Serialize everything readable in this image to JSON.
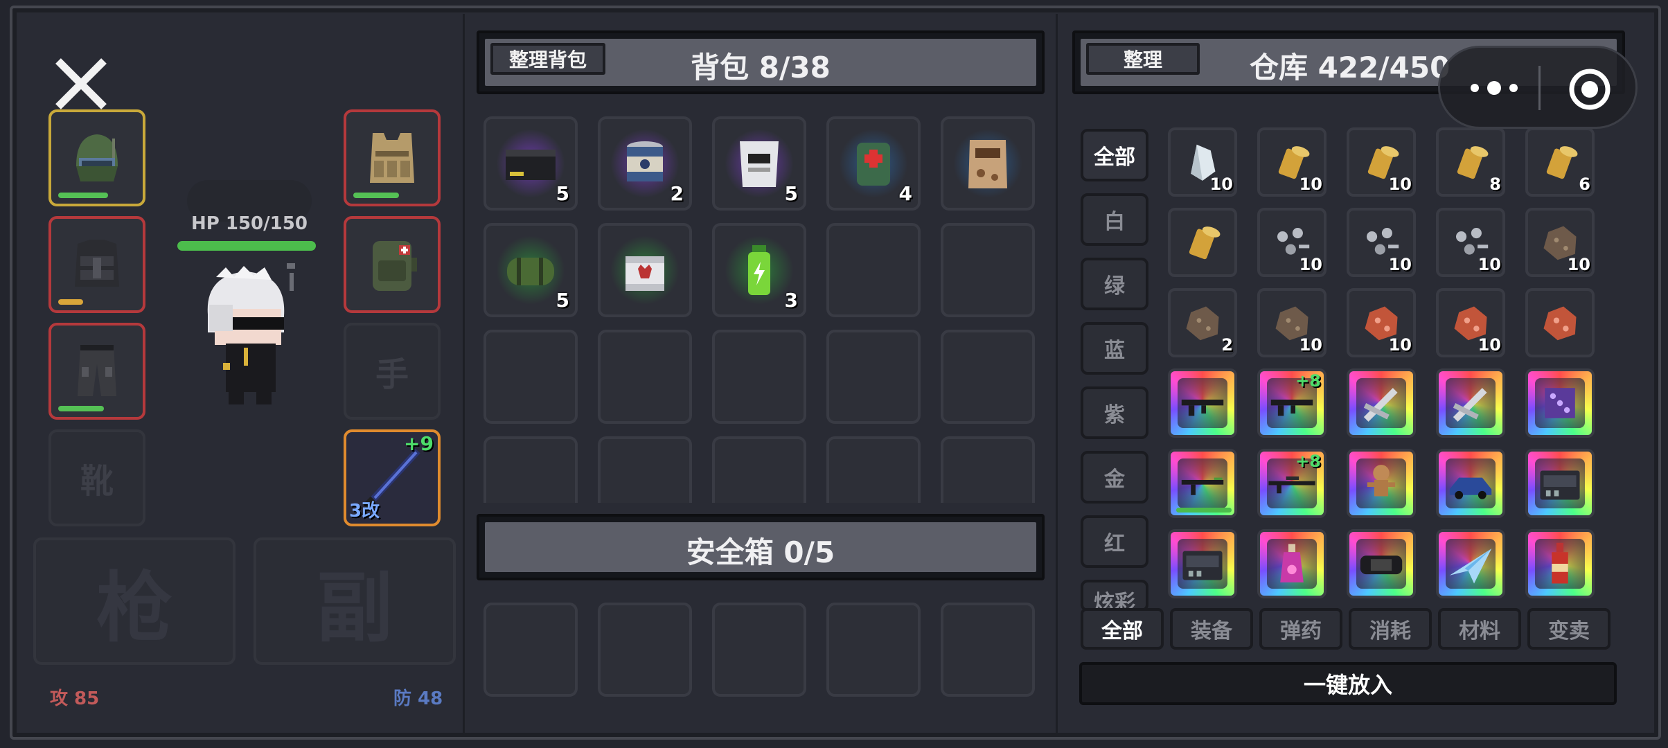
{
  "close_icon": "close-icon",
  "character": {
    "hp_label": "HP 150/150",
    "hp_fraction": 1.0,
    "attack_label": "攻 85",
    "defense_label": "防 48"
  },
  "equipment": {
    "helmet_durability": 0.6,
    "vest_durability": 0.3,
    "pants_durability": 0.55,
    "armor_durability": 0.55,
    "weapon_plus": "+9",
    "weapon_mod": "3改",
    "hand_slot": "手",
    "boots_slot": "靴",
    "gun_slot": "枪",
    "sub_slot": "副"
  },
  "backpack": {
    "sort_button": "整理背包",
    "title": "背包 8/38",
    "items": [
      {
        "name": "ammo-crate",
        "qty": "5",
        "glow": "#6a3aa8"
      },
      {
        "name": "canned-food",
        "qty": "2",
        "glow": "#6a3aa8"
      },
      {
        "name": "ration-pack",
        "qty": "5",
        "glow": "#6a3aa8"
      },
      {
        "name": "medkit-pouch",
        "qty": "4",
        "glow": "#2d5a8a"
      },
      {
        "name": "mre-pack",
        "qty": "",
        "glow": "#2d5a8a"
      },
      {
        "name": "sleeping-roll",
        "qty": "5",
        "glow": "#2d7a3a"
      },
      {
        "name": "wolf-can",
        "qty": "",
        "glow": "#2d7a3a"
      },
      {
        "name": "energy-drink",
        "qty": "3",
        "glow": "#2d7a3a"
      }
    ]
  },
  "safebox": {
    "title": "安全箱 0/5"
  },
  "warehouse": {
    "sort_button": "整理",
    "title": "仓库 422/450",
    "categories": [
      "全部",
      "白",
      "绿",
      "蓝",
      "紫",
      "金",
      "红",
      "炫彩"
    ],
    "tabs": [
      "全部",
      "装备",
      "弹药",
      "消耗",
      "材料",
      "变卖"
    ],
    "put_all": "一键放入",
    "items": [
      {
        "name": "crystal-shard",
        "qty": "10",
        "plus": ""
      },
      {
        "name": "bullet",
        "qty": "10",
        "plus": ""
      },
      {
        "name": "bullet",
        "qty": "10",
        "plus": ""
      },
      {
        "name": "bullet",
        "qty": "8",
        "plus": ""
      },
      {
        "name": "bullet",
        "qty": "6",
        "plus": ""
      },
      {
        "name": "bullet",
        "qty": "",
        "plus": ""
      },
      {
        "name": "scrap-bolts",
        "qty": "10",
        "plus": ""
      },
      {
        "name": "scrap-bolts",
        "qty": "10",
        "plus": ""
      },
      {
        "name": "scrap-bolts",
        "qty": "10",
        "plus": ""
      },
      {
        "name": "iron-ore",
        "qty": "10",
        "plus": ""
      },
      {
        "name": "iron-ore",
        "qty": "2",
        "plus": ""
      },
      {
        "name": "iron-ore",
        "qty": "10",
        "plus": ""
      },
      {
        "name": "copper-ore",
        "qty": "10",
        "plus": ""
      },
      {
        "name": "copper-ore",
        "qty": "10",
        "plus": ""
      },
      {
        "name": "copper-ore",
        "qty": "",
        "plus": ""
      },
      {
        "name": "assault-rifle",
        "qty": "",
        "plus": ""
      },
      {
        "name": "assault-rifle",
        "qty": "",
        "plus": "+8"
      },
      {
        "name": "multi-tool",
        "qty": "",
        "plus": ""
      },
      {
        "name": "multi-tool",
        "qty": "",
        "plus": ""
      },
      {
        "name": "mystery-cube",
        "qty": "",
        "plus": ""
      },
      {
        "name": "smg",
        "qty": "",
        "plus": ""
      },
      {
        "name": "sniper-rifle",
        "qty": "",
        "plus": "+8"
      },
      {
        "name": "voodoo-doll",
        "qty": "",
        "plus": ""
      },
      {
        "name": "sports-car",
        "qty": "",
        "plus": ""
      },
      {
        "name": "tool-case",
        "qty": "",
        "plus": ""
      },
      {
        "name": "tool-case",
        "qty": "",
        "plus": ""
      },
      {
        "name": "potion",
        "qty": "",
        "plus": ""
      },
      {
        "name": "game-console",
        "qty": "",
        "plus": ""
      },
      {
        "name": "paper-plane",
        "qty": "",
        "plus": ""
      },
      {
        "name": "soda-bottle",
        "qty": "",
        "plus": ""
      }
    ]
  },
  "menu_capsule": {
    "more_icon": "more-dots-icon",
    "target_icon": "target-icon"
  }
}
